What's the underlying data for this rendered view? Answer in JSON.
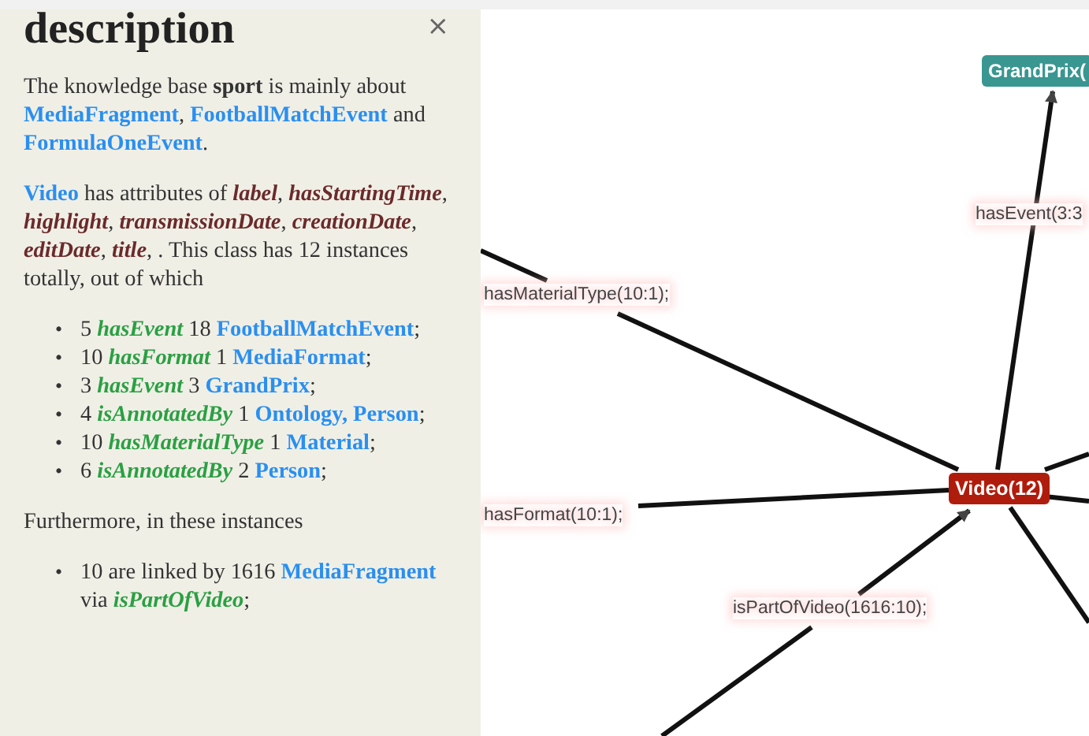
{
  "panel": {
    "title": "description",
    "close": "×",
    "paragraphs": [
      [
        {
          "kind": "text",
          "text": "The knowledge base "
        },
        {
          "kind": "bold",
          "text": "sport"
        },
        {
          "kind": "text",
          "text": " is mainly about "
        },
        {
          "kind": "link",
          "text": "MediaFragment"
        },
        {
          "kind": "text",
          "text": ", "
        },
        {
          "kind": "link",
          "text": "FootballMatchEvent"
        },
        {
          "kind": "text",
          "text": " and "
        },
        {
          "kind": "link",
          "text": "FormulaOneEvent"
        },
        {
          "kind": "text",
          "text": "."
        }
      ],
      [
        {
          "kind": "link",
          "text": "Video"
        },
        {
          "kind": "text",
          "text": " has attributes of "
        },
        {
          "kind": "attribute",
          "text": "label"
        },
        {
          "kind": "text",
          "text": ", "
        },
        {
          "kind": "attribute",
          "text": "hasStartingTime"
        },
        {
          "kind": "text",
          "text": ", "
        },
        {
          "kind": "attribute",
          "text": "highlight"
        },
        {
          "kind": "text",
          "text": ", "
        },
        {
          "kind": "attribute",
          "text": "transmissionDate"
        },
        {
          "kind": "text",
          "text": ", "
        },
        {
          "kind": "attribute",
          "text": "creationDate"
        },
        {
          "kind": "text",
          "text": ", "
        },
        {
          "kind": "attribute",
          "text": "editDate"
        },
        {
          "kind": "text",
          "text": ", "
        },
        {
          "kind": "attribute",
          "text": "title"
        },
        {
          "kind": "text",
          "text": ", . This class has 12 instances totally, out of which"
        }
      ]
    ],
    "marker": "•",
    "relations": [
      [
        {
          "kind": "text",
          "text": "5 "
        },
        {
          "kind": "relation",
          "text": "hasEvent"
        },
        {
          "kind": "text",
          "text": " 18 "
        },
        {
          "kind": "link",
          "text": "FootballMatchEvent"
        },
        {
          "kind": "text",
          "text": ";"
        }
      ],
      [
        {
          "kind": "text",
          "text": "10 "
        },
        {
          "kind": "relation",
          "text": "hasFormat"
        },
        {
          "kind": "text",
          "text": " 1 "
        },
        {
          "kind": "link",
          "text": "MediaFormat"
        },
        {
          "kind": "text",
          "text": ";"
        }
      ],
      [
        {
          "kind": "text",
          "text": "3 "
        },
        {
          "kind": "relation",
          "text": "hasEvent"
        },
        {
          "kind": "text",
          "text": " 3 "
        },
        {
          "kind": "link",
          "text": "GrandPrix"
        },
        {
          "kind": "text",
          "text": ";"
        }
      ],
      [
        {
          "kind": "text",
          "text": "4 "
        },
        {
          "kind": "relation",
          "text": "isAnnotatedBy"
        },
        {
          "kind": "text",
          "text": " 1 "
        },
        {
          "kind": "link",
          "text": "Ontology, Person"
        },
        {
          "kind": "text",
          "text": ";"
        }
      ],
      [
        {
          "kind": "text",
          "text": "10 "
        },
        {
          "kind": "relation",
          "text": "hasMaterialType"
        },
        {
          "kind": "text",
          "text": " 1 "
        },
        {
          "kind": "link",
          "text": "Material"
        },
        {
          "kind": "text",
          "text": ";"
        }
      ],
      [
        {
          "kind": "text",
          "text": "6 "
        },
        {
          "kind": "relation",
          "text": "isAnnotatedBy"
        },
        {
          "kind": "text",
          "text": " 2 "
        },
        {
          "kind": "link",
          "text": "Person"
        },
        {
          "kind": "text",
          "text": ";"
        }
      ]
    ],
    "furthermore": "Furthermore, in these instances",
    "incoming": [
      [
        {
          "kind": "text",
          "text": "10 are linked by 1616 "
        },
        {
          "kind": "link",
          "text": "MediaFragment"
        },
        {
          "kind": "text",
          "text": " via "
        },
        {
          "kind": "relation",
          "text": "isPartOfVideo"
        },
        {
          "kind": "text",
          "text": ";"
        }
      ]
    ]
  },
  "graph": {
    "nodes": [
      {
        "label": "GrandPrix(",
        "color": "#3a9690"
      },
      {
        "label": "Video(12)",
        "color": "#b01c0c"
      }
    ],
    "edge_labels": [
      "hasEvent(3:3",
      "hasMaterialType(10:1);",
      "hasFormat(10:1);",
      "isPartOfVideo(1616:10);"
    ]
  }
}
